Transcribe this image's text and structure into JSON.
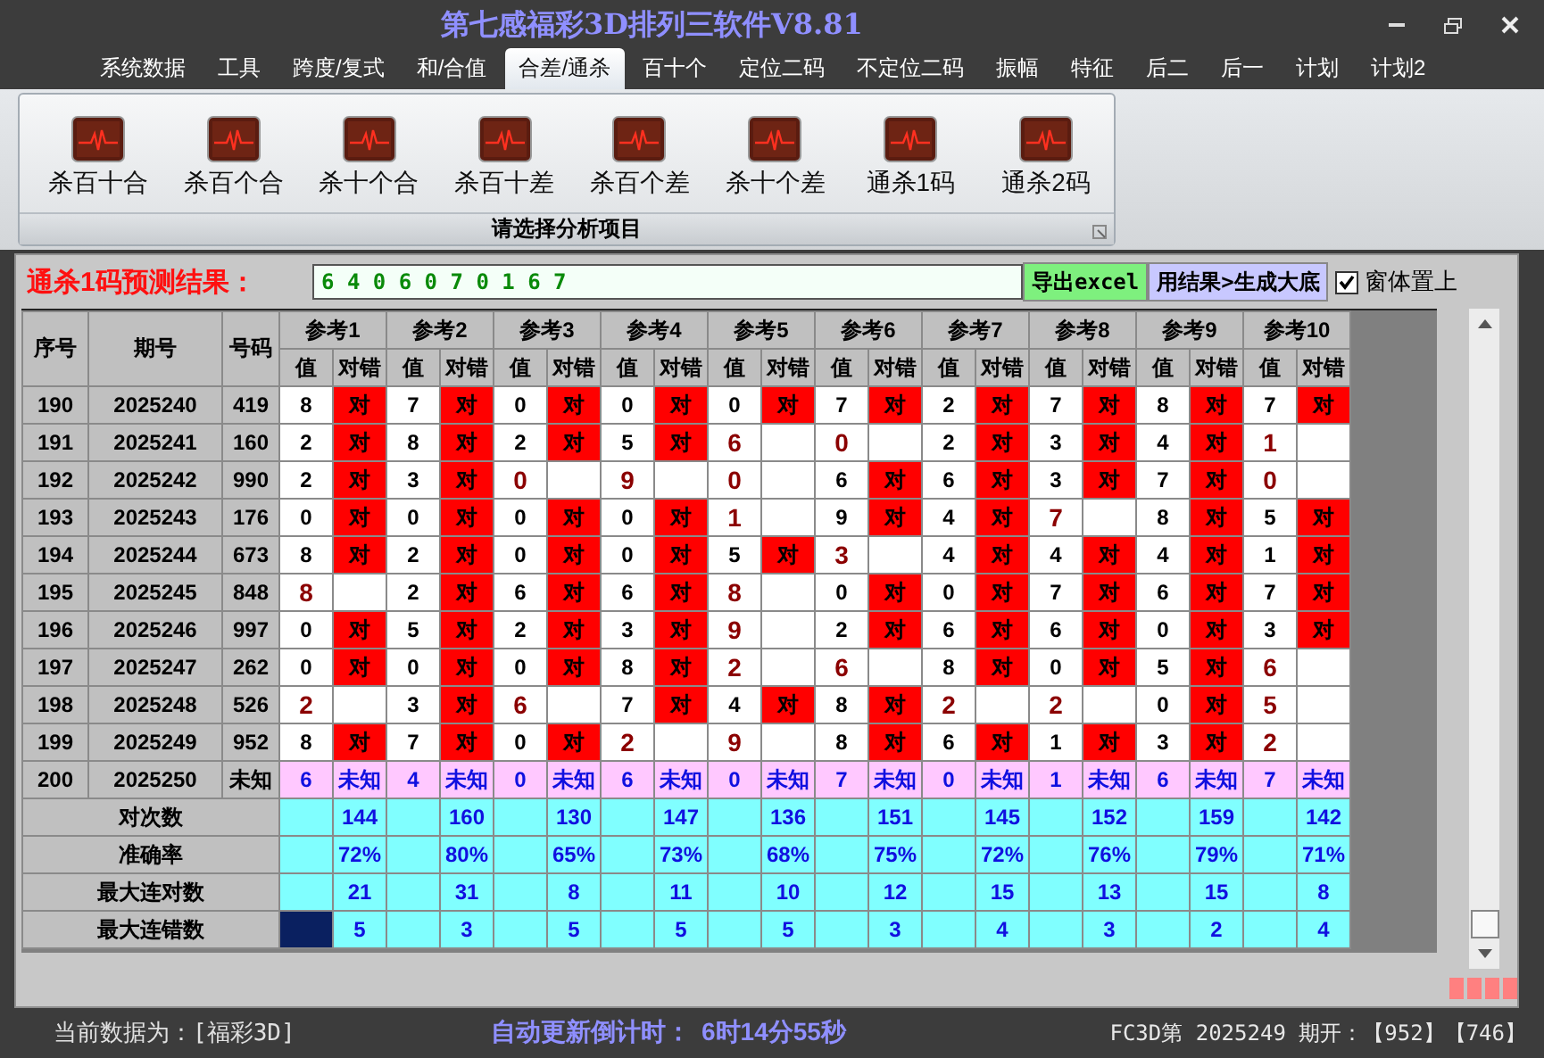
{
  "window": {
    "title": "第七感福彩3D排列三软件V8.81"
  },
  "menu": [
    {
      "label": "系统数据",
      "selected": false
    },
    {
      "label": "工具",
      "selected": false
    },
    {
      "label": "跨度/复式",
      "selected": false
    },
    {
      "label": "和/合值",
      "selected": false
    },
    {
      "label": "合差/通杀",
      "selected": true
    },
    {
      "label": "百十个",
      "selected": false
    },
    {
      "label": "定位二码",
      "selected": false
    },
    {
      "label": "不定位二码",
      "selected": false
    },
    {
      "label": "振幅",
      "selected": false
    },
    {
      "label": "特征",
      "selected": false
    },
    {
      "label": "后二",
      "selected": false
    },
    {
      "label": "后一",
      "selected": false
    },
    {
      "label": "计划",
      "selected": false
    },
    {
      "label": "计划2",
      "selected": false
    }
  ],
  "ribbon": {
    "buttons": [
      "杀百十合",
      "杀百个合",
      "杀十个合",
      "杀百十差",
      "杀百个差",
      "杀十个差",
      "通杀1码",
      "通杀2码"
    ],
    "group_label": "请选择分析项目"
  },
  "prediction": {
    "label": "通杀1码预测结果：",
    "value": "6 4 0 6 0 7 0 1 6 7",
    "buttons": [
      {
        "label": "导出excel",
        "kind": "export"
      },
      {
        "label": "用结果>生成大底",
        "kind": "generate"
      }
    ],
    "pin": {
      "label": "窗体置上",
      "checked": true
    }
  },
  "table": {
    "columns": [
      "序号",
      "期号",
      "号码"
    ],
    "refs": [
      {
        "label": "参考1",
        "sub": [
          "值",
          "对错"
        ]
      },
      {
        "label": "参考2",
        "sub": [
          "值",
          "对错"
        ]
      },
      {
        "label": "参考3",
        "sub": [
          "值",
          "对错"
        ]
      },
      {
        "label": "参考4",
        "sub": [
          "值",
          "对错"
        ]
      },
      {
        "label": "参考5",
        "sub": [
          "值",
          "对错"
        ]
      },
      {
        "label": "参考6",
        "sub": [
          "值",
          "对错"
        ]
      },
      {
        "label": "参考7",
        "sub": [
          "值",
          "对错"
        ]
      },
      {
        "label": "参考8",
        "sub": [
          "值",
          "对错"
        ]
      },
      {
        "label": "参考9",
        "sub": [
          "值",
          "对错"
        ]
      },
      {
        "label": "参考10",
        "sub": [
          "值",
          "对错"
        ]
      }
    ],
    "rows": [
      {
        "kind": "result",
        "no": "190",
        "period": "2025240",
        "number": "419",
        "cells": [
          {
            "value": "8",
            "hit": true,
            "mark": "对"
          },
          {
            "value": "7",
            "hit": true,
            "mark": "对"
          },
          {
            "value": "0",
            "hit": true,
            "mark": "对"
          },
          {
            "value": "0",
            "hit": true,
            "mark": "对"
          },
          {
            "value": "0",
            "hit": true,
            "mark": "对"
          },
          {
            "value": "7",
            "hit": true,
            "mark": "对"
          },
          {
            "value": "2",
            "hit": true,
            "mark": "对"
          },
          {
            "value": "7",
            "hit": true,
            "mark": "对"
          },
          {
            "value": "8",
            "hit": true,
            "mark": "对"
          },
          {
            "value": "7",
            "hit": true,
            "mark": "对"
          }
        ]
      },
      {
        "kind": "result",
        "no": "191",
        "period": "2025241",
        "number": "160",
        "cells": [
          {
            "value": "2",
            "hit": true,
            "mark": "对"
          },
          {
            "value": "8",
            "hit": true,
            "mark": "对"
          },
          {
            "value": "2",
            "hit": true,
            "mark": "对"
          },
          {
            "value": "5",
            "hit": true,
            "mark": "对"
          },
          {
            "value": "6",
            "hit": false
          },
          {
            "value": "0",
            "hit": false
          },
          {
            "value": "2",
            "hit": true,
            "mark": "对"
          },
          {
            "value": "3",
            "hit": true,
            "mark": "对"
          },
          {
            "value": "4",
            "hit": true,
            "mark": "对"
          },
          {
            "value": "1",
            "hit": false
          }
        ]
      },
      {
        "kind": "result",
        "no": "192",
        "period": "2025242",
        "number": "990",
        "cells": [
          {
            "value": "2",
            "hit": true,
            "mark": "对"
          },
          {
            "value": "3",
            "hit": true,
            "mark": "对"
          },
          {
            "value": "0",
            "hit": false
          },
          {
            "value": "9",
            "hit": false
          },
          {
            "value": "0",
            "hit": false
          },
          {
            "value": "6",
            "hit": true,
            "mark": "对"
          },
          {
            "value": "6",
            "hit": true,
            "mark": "对"
          },
          {
            "value": "3",
            "hit": true,
            "mark": "对"
          },
          {
            "value": "7",
            "hit": true,
            "mark": "对"
          },
          {
            "value": "0",
            "hit": false
          }
        ]
      },
      {
        "kind": "result",
        "no": "193",
        "period": "2025243",
        "number": "176",
        "cells": [
          {
            "value": "0",
            "hit": true,
            "mark": "对"
          },
          {
            "value": "0",
            "hit": true,
            "mark": "对"
          },
          {
            "value": "0",
            "hit": true,
            "mark": "对"
          },
          {
            "value": "0",
            "hit": true,
            "mark": "对"
          },
          {
            "value": "1",
            "hit": false
          },
          {
            "value": "9",
            "hit": true,
            "mark": "对"
          },
          {
            "value": "4",
            "hit": true,
            "mark": "对"
          },
          {
            "value": "7",
            "hit": false
          },
          {
            "value": "8",
            "hit": true,
            "mark": "对"
          },
          {
            "value": "5",
            "hit": true,
            "mark": "对"
          }
        ]
      },
      {
        "kind": "result",
        "no": "194",
        "period": "2025244",
        "number": "673",
        "cells": [
          {
            "value": "8",
            "hit": true,
            "mark": "对"
          },
          {
            "value": "2",
            "hit": true,
            "mark": "对"
          },
          {
            "value": "0",
            "hit": true,
            "mark": "对"
          },
          {
            "value": "0",
            "hit": true,
            "mark": "对"
          },
          {
            "value": "5",
            "hit": true,
            "mark": "对"
          },
          {
            "value": "3",
            "hit": false
          },
          {
            "value": "4",
            "hit": true,
            "mark": "对"
          },
          {
            "value": "4",
            "hit": true,
            "mark": "对"
          },
          {
            "value": "4",
            "hit": true,
            "mark": "对"
          },
          {
            "value": "1",
            "hit": true,
            "mark": "对"
          }
        ]
      },
      {
        "kind": "result",
        "no": "195",
        "period": "2025245",
        "number": "848",
        "cells": [
          {
            "value": "8",
            "hit": false
          },
          {
            "value": "2",
            "hit": true,
            "mark": "对"
          },
          {
            "value": "6",
            "hit": true,
            "mark": "对"
          },
          {
            "value": "6",
            "hit": true,
            "mark": "对"
          },
          {
            "value": "8",
            "hit": false
          },
          {
            "value": "0",
            "hit": true,
            "mark": "对"
          },
          {
            "value": "0",
            "hit": true,
            "mark": "对"
          },
          {
            "value": "7",
            "hit": true,
            "mark": "对"
          },
          {
            "value": "6",
            "hit": true,
            "mark": "对"
          },
          {
            "value": "7",
            "hit": true,
            "mark": "对"
          }
        ]
      },
      {
        "kind": "result",
        "no": "196",
        "period": "2025246",
        "number": "997",
        "cells": [
          {
            "value": "0",
            "hit": true,
            "mark": "对"
          },
          {
            "value": "5",
            "hit": true,
            "mark": "对"
          },
          {
            "value": "2",
            "hit": true,
            "mark": "对"
          },
          {
            "value": "3",
            "hit": true,
            "mark": "对"
          },
          {
            "value": "9",
            "hit": false
          },
          {
            "value": "2",
            "hit": true,
            "mark": "对"
          },
          {
            "value": "6",
            "hit": true,
            "mark": "对"
          },
          {
            "value": "6",
            "hit": true,
            "mark": "对"
          },
          {
            "value": "0",
            "hit": true,
            "mark": "对"
          },
          {
            "value": "3",
            "hit": true,
            "mark": "对"
          }
        ]
      },
      {
        "kind": "result",
        "no": "197",
        "period": "2025247",
        "number": "262",
        "cells": [
          {
            "value": "0",
            "hit": true,
            "mark": "对"
          },
          {
            "value": "0",
            "hit": true,
            "mark": "对"
          },
          {
            "value": "0",
            "hit": true,
            "mark": "对"
          },
          {
            "value": "8",
            "hit": true,
            "mark": "对"
          },
          {
            "value": "2",
            "hit": false
          },
          {
            "value": "6",
            "hit": false
          },
          {
            "value": "8",
            "hit": true,
            "mark": "对"
          },
          {
            "value": "0",
            "hit": true,
            "mark": "对"
          },
          {
            "value": "5",
            "hit": true,
            "mark": "对"
          },
          {
            "value": "6",
            "hit": false
          }
        ]
      },
      {
        "kind": "result",
        "no": "198",
        "period": "2025248",
        "number": "526",
        "cells": [
          {
            "value": "2",
            "hit": false
          },
          {
            "value": "3",
            "hit": true,
            "mark": "对"
          },
          {
            "value": "6",
            "hit": false
          },
          {
            "value": "7",
            "hit": true,
            "mark": "对"
          },
          {
            "value": "4",
            "hit": true,
            "mark": "对"
          },
          {
            "value": "8",
            "hit": true,
            "mark": "对"
          },
          {
            "value": "2",
            "hit": false
          },
          {
            "value": "2",
            "hit": false
          },
          {
            "value": "0",
            "hit": true,
            "mark": "对"
          },
          {
            "value": "5",
            "hit": false
          }
        ]
      },
      {
        "kind": "result",
        "no": "199",
        "period": "2025249",
        "number": "952",
        "cells": [
          {
            "value": "8",
            "hit": true,
            "mark": "对"
          },
          {
            "value": "7",
            "hit": true,
            "mark": "对"
          },
          {
            "value": "0",
            "hit": true,
            "mark": "对"
          },
          {
            "value": "2",
            "hit": false
          },
          {
            "value": "9",
            "hit": false
          },
          {
            "value": "8",
            "hit": true,
            "mark": "对"
          },
          {
            "value": "6",
            "hit": true,
            "mark": "对"
          },
          {
            "value": "1",
            "hit": true,
            "mark": "对"
          },
          {
            "value": "3",
            "hit": true,
            "mark": "对"
          },
          {
            "value": "2",
            "hit": false
          }
        ]
      },
      {
        "kind": "pending",
        "no": "200",
        "period": "2025250",
        "number": "未知",
        "cells": [
          {
            "value": "6",
            "mark": "未知"
          },
          {
            "value": "4",
            "mark": "未知"
          },
          {
            "value": "0",
            "mark": "未知"
          },
          {
            "value": "6",
            "mark": "未知"
          },
          {
            "value": "0",
            "mark": "未知"
          },
          {
            "value": "7",
            "mark": "未知"
          },
          {
            "value": "0",
            "mark": "未知"
          },
          {
            "value": "1",
            "mark": "未知"
          },
          {
            "value": "6",
            "mark": "未知"
          },
          {
            "value": "7",
            "mark": "未知"
          }
        ]
      }
    ],
    "summary": [
      {
        "label": "对次数",
        "cursor": false,
        "values": [
          "144",
          "160",
          "130",
          "147",
          "136",
          "151",
          "145",
          "152",
          "159",
          "142"
        ]
      },
      {
        "label": "准确率",
        "cursor": false,
        "values": [
          "72%",
          "80%",
          "65%",
          "73%",
          "68%",
          "75%",
          "72%",
          "76%",
          "79%",
          "71%"
        ]
      },
      {
        "label": "最大连对数",
        "cursor": false,
        "values": [
          "21",
          "31",
          "8",
          "11",
          "10",
          "12",
          "15",
          "13",
          "15",
          "8"
        ]
      },
      {
        "label": "最大连错数",
        "cursor": true,
        "values": [
          "5",
          "3",
          "5",
          "5",
          "5",
          "3",
          "4",
          "3",
          "2",
          "4"
        ]
      }
    ]
  },
  "status_bar": {
    "source": "当前数据为：[福彩3D]",
    "countdown_label": "自动更新倒计时：",
    "countdown": "6时14分55秒",
    "draw": "FC3D第 2025249 期开：【952】【746】"
  }
}
